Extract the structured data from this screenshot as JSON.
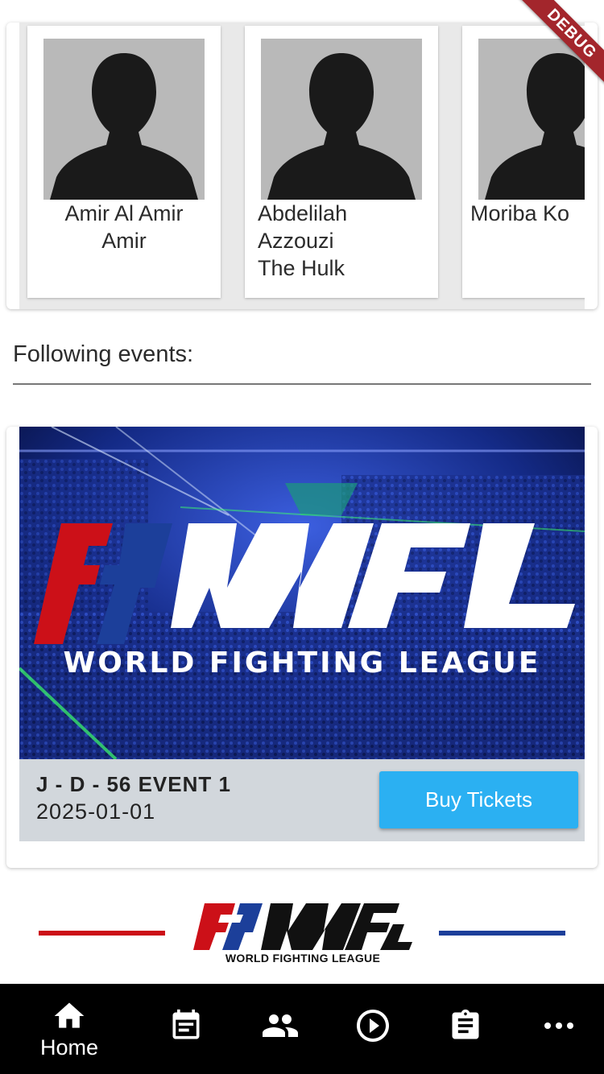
{
  "fighters": [
    {
      "name": "Amir Al Amir\nAmir",
      "align": "center"
    },
    {
      "name": "Abdelilah\nAzzouzi\n       The Hulk",
      "align": "left"
    },
    {
      "name": "Moriba Ko",
      "align": "left"
    }
  ],
  "debug_banner": "DEBUG",
  "section": {
    "title": "Following events:"
  },
  "event": {
    "banner_logo": "WFL",
    "banner_subtitle": "WORLD FIGHTING LEAGUE",
    "name": "J - D - 56 EVENT 1",
    "date": "2025-01-01",
    "buy_label": "Buy Tickets"
  },
  "footer": {
    "logo_text": "WFL",
    "logo_subtitle": "WORLD FIGHTING LEAGUE"
  },
  "nav": {
    "items": [
      {
        "icon": "home-icon",
        "label": "Home",
        "active": true
      },
      {
        "icon": "calendar-icon",
        "label": ""
      },
      {
        "icon": "people-icon",
        "label": ""
      },
      {
        "icon": "play-circle-icon",
        "label": ""
      },
      {
        "icon": "clipboard-icon",
        "label": ""
      },
      {
        "icon": "more-icon",
        "label": ""
      }
    ]
  },
  "colors": {
    "accent": "#2bb0f2",
    "brand_red": "#cc1018",
    "brand_blue": "#1c3f9a",
    "nav_bg": "#000000"
  }
}
